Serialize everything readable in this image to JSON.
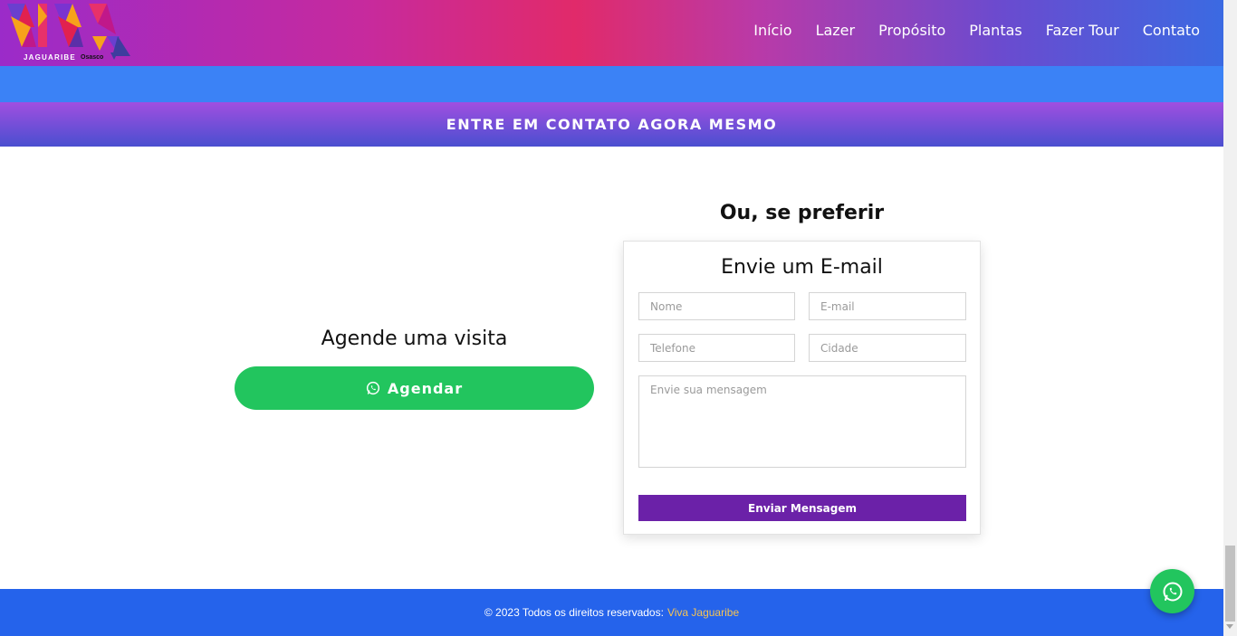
{
  "header": {
    "logo_text": "VIVA",
    "logo_subtitle": "JAGUARIBE",
    "logo_city": "Osasco",
    "nav": [
      "Início",
      "Lazer",
      "Propósito",
      "Plantas",
      "Fazer Tour",
      "Contato"
    ]
  },
  "cta_banner": "ENTRE EM CONTATO AGORA MESMO",
  "left": {
    "title": "Agende uma visita",
    "button_label": "Agendar"
  },
  "right": {
    "title": "Ou, se preferir",
    "form_title": "Envie um E-mail",
    "placeholders": {
      "name": "Nome",
      "email": "E-mail",
      "phone": "Telefone",
      "city": "Cidade",
      "message": "Envie sua mensagem"
    },
    "submit_label": "Enviar Mensagem"
  },
  "footer": {
    "text": "© 2023 Todos os direitos reservados:",
    "brand": "Viva Jaguaribe"
  },
  "colors": {
    "whatsapp_green": "#22c55e",
    "submit_purple": "#6b21a8",
    "footer_blue": "#2563eb",
    "band_blue": "#3b82f6",
    "footer_link": "#f6c453"
  },
  "icons": {
    "agendar": "whatsapp-icon",
    "floating": "whatsapp-icon"
  }
}
